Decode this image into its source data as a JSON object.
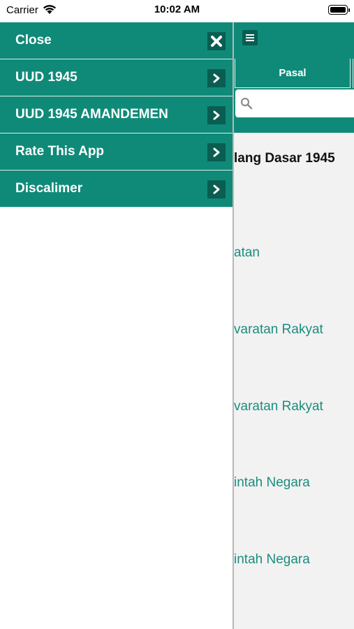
{
  "status_bar": {
    "carrier": "Carrier",
    "time": "10:02 AM"
  },
  "drawer": {
    "items": [
      {
        "label": "Close",
        "icon": "close-icon"
      },
      {
        "label": "UUD 1945",
        "icon": "chevron-right-icon"
      },
      {
        "label": "UUD 1945 AMANDEMEN",
        "icon": "chevron-right-icon"
      },
      {
        "label": "Rate This App",
        "icon": "chevron-right-icon"
      },
      {
        "label": "Discalimer",
        "icon": "chevron-right-icon"
      }
    ]
  },
  "main": {
    "menu_icon": "hamburger-icon",
    "tab_label": "Pasal",
    "search_icon": "search-icon",
    "title_visible": "lang Dasar 1945",
    "list_items_visible": [
      "atan",
      "varatan Rakyat",
      "varatan Rakyat",
      "intah Negara",
      "intah Negara"
    ]
  },
  "colors": {
    "primary": "#0f8a78",
    "primary_dark": "#0a5d51",
    "link": "#1b8d7d",
    "background": "#f2f2f2"
  }
}
